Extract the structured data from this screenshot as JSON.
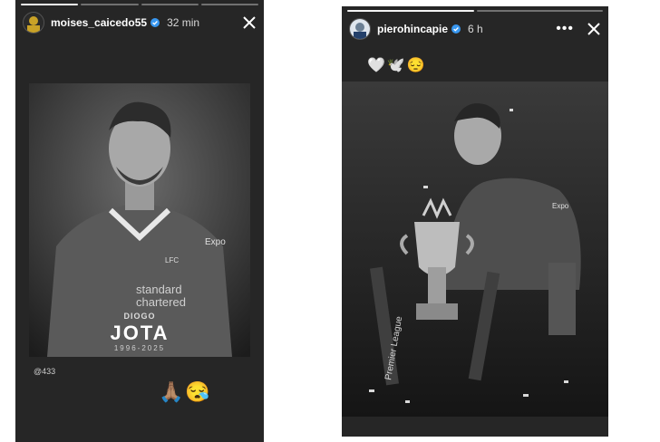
{
  "left_story": {
    "username": "moises_caicedo55",
    "time": "32 min",
    "overlay": {
      "first_name": "DIOGO",
      "last_name": "JOTA",
      "years": "1996-2025",
      "sponsor_line1": "standard",
      "sponsor_line2": "chartered",
      "club_badge": "LFC",
      "jersey_text": "Expo"
    },
    "mention": "@433",
    "reaction": "🙏🏽😪"
  },
  "right_story": {
    "username": "pierohincapie",
    "time": "6 h",
    "caption_emojis": "🤍🕊️😔",
    "trophy_ribbon": "Premier League",
    "jersey_text": "Expo"
  },
  "icons": {
    "verified": "verified-badge-icon",
    "more": "more-options-icon",
    "close": "close-icon"
  },
  "colors": {
    "story_bg": "#262626",
    "page_bg": "#ffffff",
    "verified": "#3897f0"
  }
}
